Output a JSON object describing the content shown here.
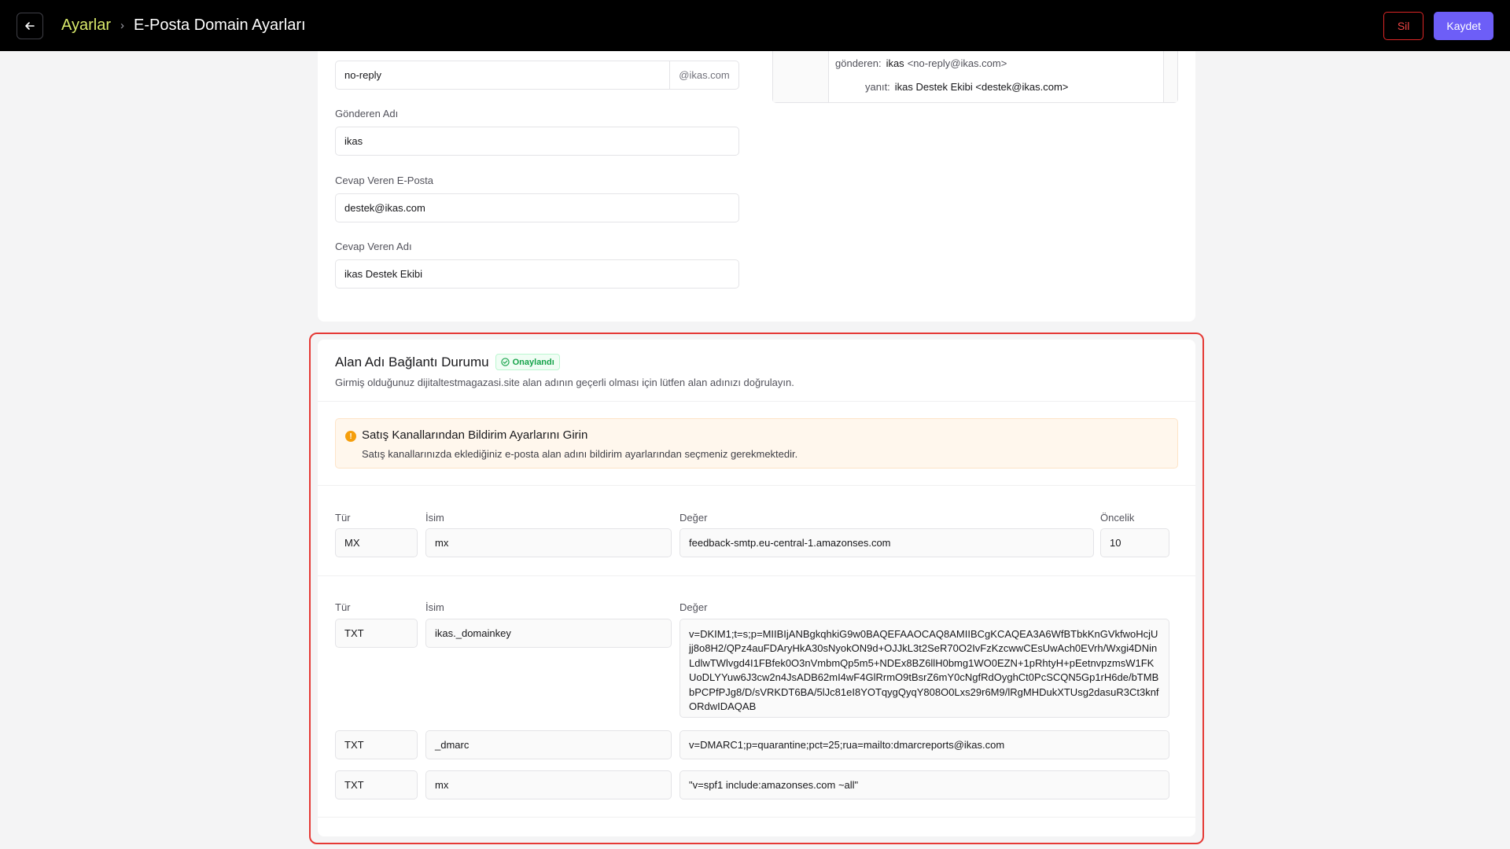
{
  "header": {
    "back_icon": "arrow-left-icon",
    "breadcrumb_parent": "Ayarlar",
    "breadcrumb_separator": "›",
    "page_title": "E-Posta Domain Ayarları",
    "delete_label": "Sil",
    "save_label": "Kaydet",
    "accent_color": "#6d5ef7"
  },
  "sender_form": {
    "sender_email_value": "no-reply",
    "sender_email_suffix": "@ikas.com",
    "sender_name_label": "Gönderen Adı",
    "sender_name_value": "ikas",
    "reply_email_label": "Cevap Veren E-Posta",
    "reply_email_value": "destek@ikas.com",
    "reply_name_label": "Cevap Veren Adı",
    "reply_name_value": "ikas Destek Ekibi"
  },
  "preview": {
    "from_label": "gönderen:",
    "from_name": "ikas",
    "from_email": "<no-reply@ikas.com>",
    "reply_label": "yanıt:",
    "reply_value": "ikas Destek Ekibi <destek@ikas.com>"
  },
  "domain_status": {
    "title": "Alan Adı Bağlantı Durumu",
    "badge": "Onaylandı",
    "badge_icon": "check-circle-icon",
    "description": "Girmiş olduğunuz dijitaltestmagazasi.site alan adının geçerli olması için lütfen alan adınızı doğrulayın."
  },
  "alert": {
    "icon": "warning-icon",
    "title": "Satış Kanallarından Bildirim Ayarlarını Girin",
    "text": "Satış kanallarınızda eklediğiniz e-posta alan adını bildirim ayarlarından seçmeniz gerekmektedir."
  },
  "mx_record": {
    "type_label": "Tür",
    "name_label": "İsim",
    "value_label": "Değer",
    "priority_label": "Öncelik",
    "type": "MX",
    "name": "mx",
    "value": "feedback-smtp.eu-central-1.amazonses.com",
    "priority": "10"
  },
  "txt_records": {
    "type_label": "Tür",
    "name_label": "İsim",
    "value_label": "Değer",
    "rows": [
      {
        "type": "TXT",
        "name": "ikas._domainkey",
        "value": "v=DKIM1;t=s;p=MIIBIjANBgkqhkiG9w0BAQEFAAOCAQ8AMIIBCgKCAQEA3A6WfBTbkKnGVkfwoHcjUjj8o8H2/QPz4auFDAryHkA30sNyokON9d+OJJkL3t2SeR70O2IvFzKzcwwCEsUwAch0EVrh/Wxgi4DNinLdlwTWlvgd4I1FBfek0O3nVmbmQp5m5+NDEx8BZ6llH0bmg1WO0EZN+1pRhtyH+pEetnvpzmsW1FKUoDLYYuw6J3cw2n4JsADB62mI4wF4GlRrmO9tBsrZ6mY0cNgfRdOyghCt0PcSCQN5Gp1rH6de/bTMBbPCPfPJg8/D/sVRKDT6BA/5lJc81eI8YOTqygQyqY808O0Lxs29r6M9/lRgMHDukXTUsg2dasuR3Ct3knfORdwIDAQAB"
      },
      {
        "type": "TXT",
        "name": "_dmarc",
        "value": "v=DMARC1;p=quarantine;pct=25;rua=mailto:dmarcreports@ikas.com"
      },
      {
        "type": "TXT",
        "name": "mx",
        "value": "\"v=spf1 include:amazonses.com ~all\""
      }
    ]
  }
}
